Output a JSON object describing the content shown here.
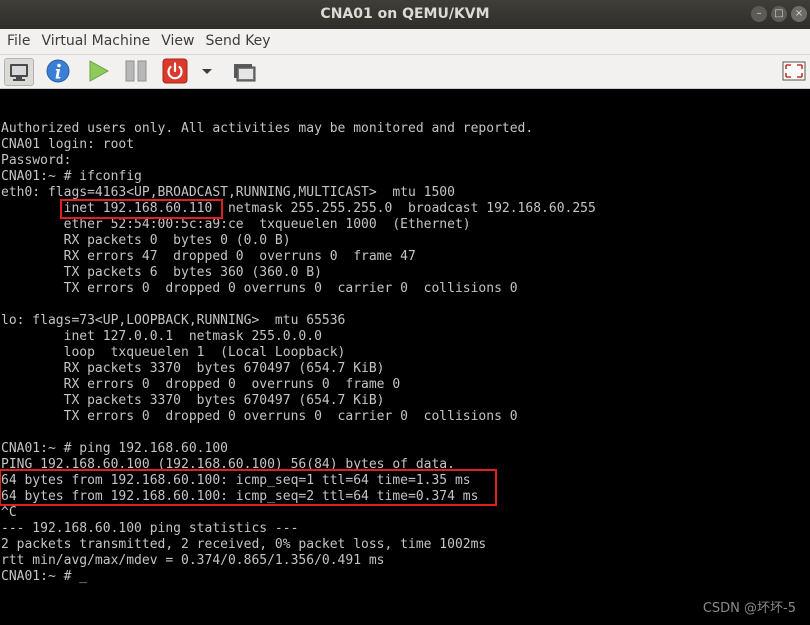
{
  "window": {
    "title": "CNA01 on QEMU/KVM",
    "minimize_glyph": "–",
    "maximize_glyph": "□",
    "close_glyph": "×"
  },
  "menubar": {
    "items": [
      {
        "label": "File"
      },
      {
        "label": "Virtual Machine"
      },
      {
        "label": "View"
      },
      {
        "label": "Send Key"
      }
    ]
  },
  "toolbar": {
    "buttons": [
      {
        "icon": "console-monitor-icon",
        "active": true
      },
      {
        "icon": "info-icon"
      },
      {
        "icon": "run-play-icon"
      },
      {
        "icon": "pause-icon"
      },
      {
        "icon": "shutdown-power-icon"
      },
      {
        "icon": "shutdown-dropdown-chevron-icon"
      },
      {
        "icon": "snapshots-icon"
      },
      {
        "icon": "fullscreen-icon"
      }
    ],
    "colors": {
      "info": "#3b7fd4",
      "play": "#7bc043",
      "power": "#d93a2b",
      "pause": "#9c9c9c"
    }
  },
  "terminal": {
    "lines": [
      "Authorized users only. All activities may be monitored and reported.",
      "CNA01 login: root",
      "Password:",
      "CNA01:~ # ifconfig",
      "eth0: flags=4163<UP,BROADCAST,RUNNING,MULTICAST>  mtu 1500",
      "        inet 192.168.60.110  netmask 255.255.255.0  broadcast 192.168.60.255",
      "        ether 52:54:00:5c:a9:ce  txqueuelen 1000  (Ethernet)",
      "        RX packets 0  bytes 0 (0.0 B)",
      "        RX errors 47  dropped 0  overruns 0  frame 47",
      "        TX packets 6  bytes 360 (360.0 B)",
      "        TX errors 0  dropped 0 overruns 0  carrier 0  collisions 0",
      "",
      "lo: flags=73<UP,LOOPBACK,RUNNING>  mtu 65536",
      "        inet 127.0.0.1  netmask 255.0.0.0",
      "        loop  txqueuelen 1  (Local Loopback)",
      "        RX packets 3370  bytes 670497 (654.7 KiB)",
      "        RX errors 0  dropped 0  overruns 0  frame 0",
      "        TX packets 3370  bytes 670497 (654.7 KiB)",
      "        TX errors 0  dropped 0 overruns 0  carrier 0  collisions 0",
      "",
      "CNA01:~ # ping 192.168.60.100",
      "PING 192.168.60.100 (192.168.60.100) 56(84) bytes of data.",
      "64 bytes from 192.168.60.100: icmp_seq=1 ttl=64 time=1.35 ms",
      "64 bytes from 192.168.60.100: icmp_seq=2 ttl=64 time=0.374 ms",
      "^C",
      "--- 192.168.60.100 ping statistics ---",
      "2 packets transmitted, 2 received, 0% packet loss, time 1002ms",
      "rtt min/avg/max/mdev = 0.374/0.865/1.356/0.491 ms",
      "CNA01:~ # _"
    ],
    "highlight_color": "#e02020"
  },
  "watermark": "CSDN @坏坏-5"
}
